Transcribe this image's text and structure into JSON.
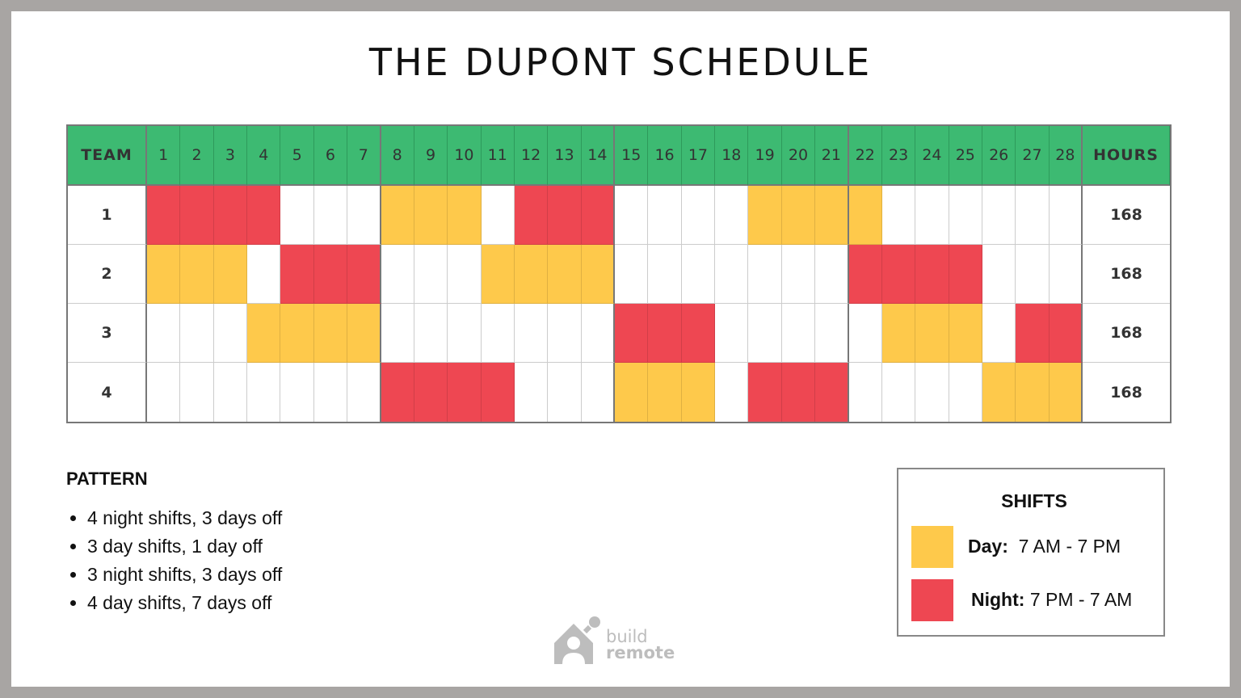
{
  "title": "THE DUPONT SCHEDULE",
  "table": {
    "team_header": "TEAM",
    "hours_header": "HOURS",
    "days": [
      "1",
      "2",
      "3",
      "4",
      "5",
      "6",
      "7",
      "8",
      "9",
      "10",
      "11",
      "12",
      "13",
      "14",
      "15",
      "16",
      "17",
      "18",
      "19",
      "20",
      "21",
      "22",
      "23",
      "24",
      "25",
      "26",
      "27",
      "28"
    ],
    "rows": [
      {
        "team": "1",
        "hours": "168",
        "shifts": "NNNN---DDD-NNN----DDDD-------"
      },
      {
        "team": "2",
        "hours": "168",
        "shifts": "DDD-NNN---DDDD-------NNNN---"
      },
      {
        "team": "3",
        "hours": "168",
        "shifts": "---DDDD-------NNN-----DDD-NNN"
      },
      {
        "team": "4",
        "hours": "168",
        "shifts": "-------NNNN---DDD-NNN----DDDD"
      }
    ]
  },
  "pattern": {
    "title": "PATTERN",
    "items": [
      "4 night shifts, 3 days off",
      "3 day shifts, 1 day off",
      "3 night shifts, 3 days off",
      "4 day shifts, 7 days off"
    ]
  },
  "legend": {
    "title": "SHIFTS",
    "day_label": "Day:",
    "day_time": "7 AM - 7 PM",
    "night_label": "Night:",
    "night_time": "7 PM - 7 AM",
    "day_color": "#fec94b",
    "night_color": "#ee4752"
  },
  "logo": {
    "line1": "build",
    "line2": "remote"
  }
}
